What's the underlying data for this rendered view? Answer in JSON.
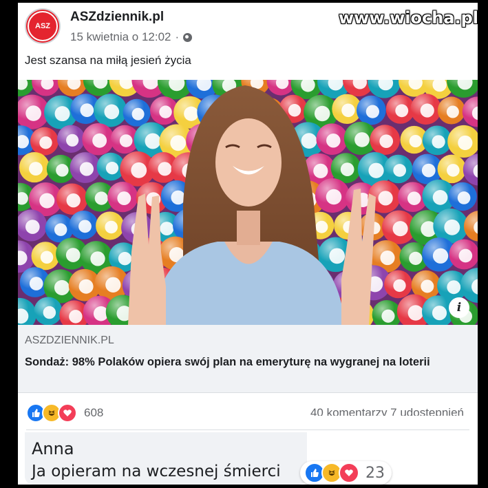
{
  "watermark": "www.wiocha.pl",
  "post": {
    "page_name": "ASZdziennik.pl",
    "avatar_text": "ASZ",
    "timestamp": "15 kwietnia o 12:02",
    "separator": "·",
    "text": "Jest szansa na miłą jesień życia"
  },
  "image": {
    "info_icon": "i"
  },
  "link_preview": {
    "domain": "ASZDZIENNIK.PL",
    "title": "Sondaż: 98% Polaków opiera swój plan na emeryturę na wygranej na loterii"
  },
  "reactions": {
    "icons": [
      "like-icon",
      "haha-icon",
      "love-icon"
    ],
    "count": "608",
    "comments_shares": "40 komentarzy  7 udostępnień"
  },
  "comment": {
    "author": "Anna",
    "text": "Ja opieram na wczesnej śmierci",
    "reaction_count": "23"
  },
  "colors": {
    "facebook_blue": "#1877f2",
    "haha_yellow": "#f7b928",
    "love_red": "#f33e58",
    "brand_red": "#e4242f"
  }
}
